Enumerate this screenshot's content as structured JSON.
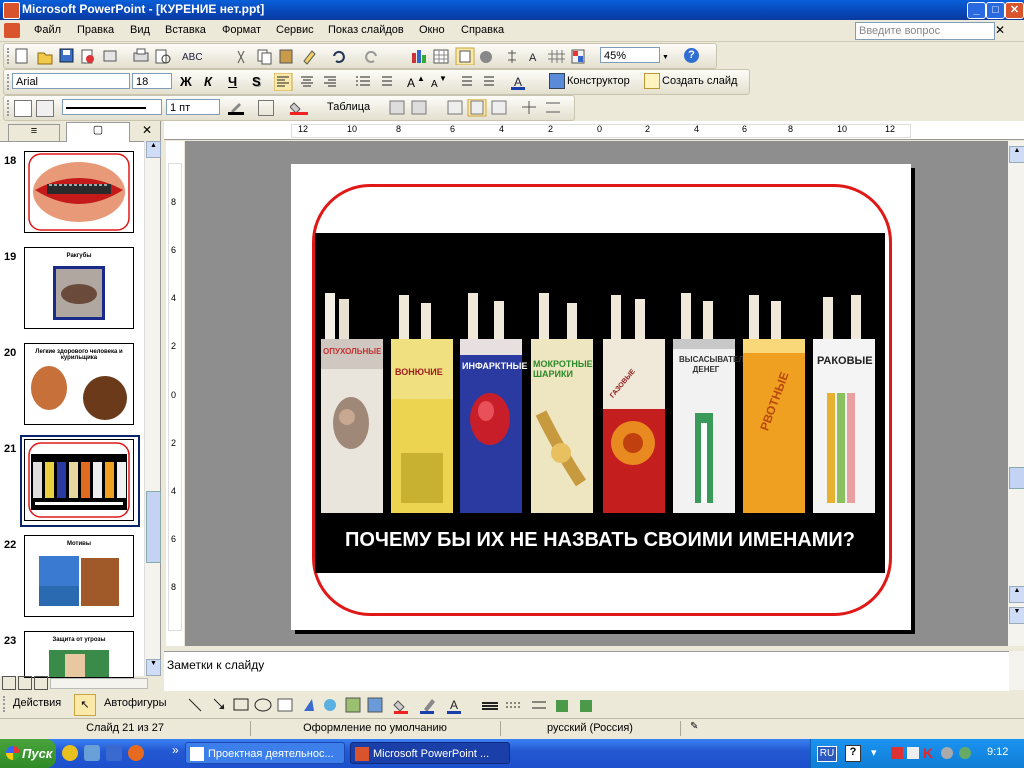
{
  "window": {
    "title": "Microsoft PowerPoint - [КУРЕНИЕ нет.ppt]",
    "buttons": [
      "_",
      "□",
      "✕"
    ]
  },
  "menubar": {
    "items": [
      "Файл",
      "Правка",
      "Вид",
      "Вставка",
      "Формат",
      "Сервис",
      "Показ слайдов",
      "Окно",
      "Справка"
    ],
    "ask_placeholder": "Введите вопрос"
  },
  "toolbar_standard": {
    "zoom": "45%"
  },
  "toolbar_format": {
    "font": "Arial",
    "size": "18",
    "bold": "Ж",
    "italic": "К",
    "underline": "Ч",
    "shadow": "S",
    "designer": "Конструктор",
    "new_slide": "Создать слайд"
  },
  "toolbar_tables": {
    "line_width": "1 пт",
    "table": "Таблица"
  },
  "ruler": {
    "top_labels": [
      "12",
      "10",
      "8",
      "6",
      "4",
      "2",
      "0",
      "2",
      "4",
      "6",
      "8",
      "10",
      "12"
    ],
    "left_labels": [
      "8",
      "6",
      "4",
      "2",
      "0",
      "2",
      "4",
      "6",
      "8"
    ]
  },
  "slides": [
    {
      "num": "18",
      "title": ""
    },
    {
      "num": "19",
      "title": "Ракгубы"
    },
    {
      "num": "20",
      "title": "Легкие здорового человека и курильщика"
    },
    {
      "num": "21",
      "title": ""
    },
    {
      "num": "22",
      "title": "Мотивы"
    },
    {
      "num": "23",
      "title": "Защита от угрозы"
    }
  ],
  "slide": {
    "packs": [
      "ОПУХОЛЬНЫЕ",
      "ВОНЮЧИЕ",
      "ИНФАРКТНЫЕ",
      "МОКРОТНЫЕ ШАРИКИ",
      "ГАЗОВЫЕ",
      "ВЫСАСЫВАТЕЛИ ДЕНЕГ",
      "РВОТНЫЕ",
      "РАКОВЫЕ"
    ],
    "caption": "ПОЧЕМУ БЫ ИХ НЕ НАЗВАТЬ СВОИМИ ИМЕНАМИ?"
  },
  "notes": {
    "placeholder": "Заметки к слайду"
  },
  "drawbar": {
    "actions": "Действия",
    "autoshapes": "Автофигуры"
  },
  "status": {
    "slide": "Слайд 21 из 27",
    "design": "Оформление по умолчанию",
    "lang": "русский (Россия)"
  },
  "taskbar": {
    "start": "Пуск",
    "task1": "Проектная деятельнос...",
    "task2": "Microsoft PowerPoint ...",
    "lang": "RU",
    "time": "9:12"
  },
  "colors": {
    "accent": "#0a5fd8",
    "slide_border": "#e01818"
  }
}
